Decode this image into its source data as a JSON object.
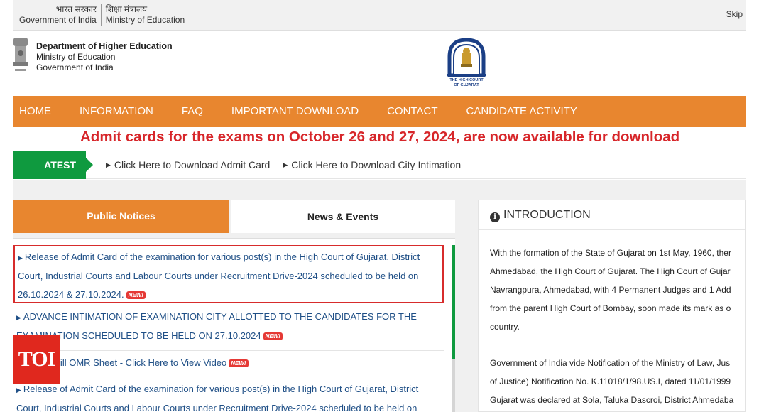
{
  "govbar": {
    "hindi_gov": "भारत सरकार",
    "english_gov": "Government of India",
    "hindi_ministry": "शिक्षा मंत्रालय",
    "english_ministry": "Ministry of Education",
    "skip": "Skip"
  },
  "header": {
    "dept_name": "Department of Higher Education",
    "ministry": "Ministry of Education",
    "government": "Government of India",
    "hc_logo_line1": "THE HIGH COURT",
    "hc_logo_line2": "OF GUJARAT"
  },
  "nav": {
    "items": [
      "HOME",
      "INFORMATION",
      "FAQ",
      "IMPORTANT DOWNLOAD",
      "CONTACT",
      "CANDIDATE ACTIVITY"
    ]
  },
  "marquee": {
    "text": "Admit cards for the exams on October 26 and 27, 2024, are now available for download"
  },
  "latest_news": {
    "label": "ATEST NEWS",
    "links": [
      "Click Here to Download Admit Card",
      "Click Here to Download City Intimation"
    ]
  },
  "tabs": {
    "public_notices": "Public Notices",
    "news_events": "News & Events"
  },
  "notices": [
    {
      "line1": "Release of Admit Card of the examination for various post(s) in the High Court of Gujarat, District",
      "line2": "Court, Industrial Courts and Labour Courts under Recruitment Drive-2024 scheduled to be held on",
      "line3": "26.10.2024 & 27.10.2024.",
      "badge": "NEW!"
    },
    {
      "line1": "ADVANCE INTIMATION OF EXAMINATION CITY ALLOTTED TO THE CANDIDATES FOR THE",
      "line2": "EXAMINATION SCHEDULED TO BE HELD ON 27.10.2024",
      "badge": "NEW!"
    },
    {
      "line1": "How to Fill OMR Sheet - Click Here to View Video",
      "badge": "NEW!"
    },
    {
      "line1": "Release of Admit Card of the examination for various post(s) in the High Court of Gujarat, District",
      "line2": "Court, Industrial Courts and Labour Courts under Recruitment Drive-2024 scheduled to be held on"
    }
  ],
  "intro": {
    "title": "INTRODUCTION",
    "lines": [
      "With the formation of the State of Gujarat on 1st May, 1960, ther",
      "Ahmedabad, the High Court of Gujarat. The High Court of Gujar",
      "Navrangpura, Ahmedabad, with 4 Permanent Judges and 1 Add",
      "from the parent High Court of Bombay, soon made its mark as o",
      "country.",
      "Government of India vide Notification of the Ministry of Law, Jus",
      "of Justice) Notification No. K.11018/1/98.US.I, dated 11/01/1999",
      "Gujarat was declared at Sola, Taluka Dascroi, District Ahmedaba"
    ]
  },
  "watermark": {
    "text": "TOI"
  },
  "colors": {
    "nav_orange": "#e8862f",
    "news_green": "#0f9a3f",
    "marquee_red": "#d7262a",
    "link_blue": "#1f4f86",
    "highlight_red": "#d72c2c",
    "toi_red": "#e0281e"
  }
}
